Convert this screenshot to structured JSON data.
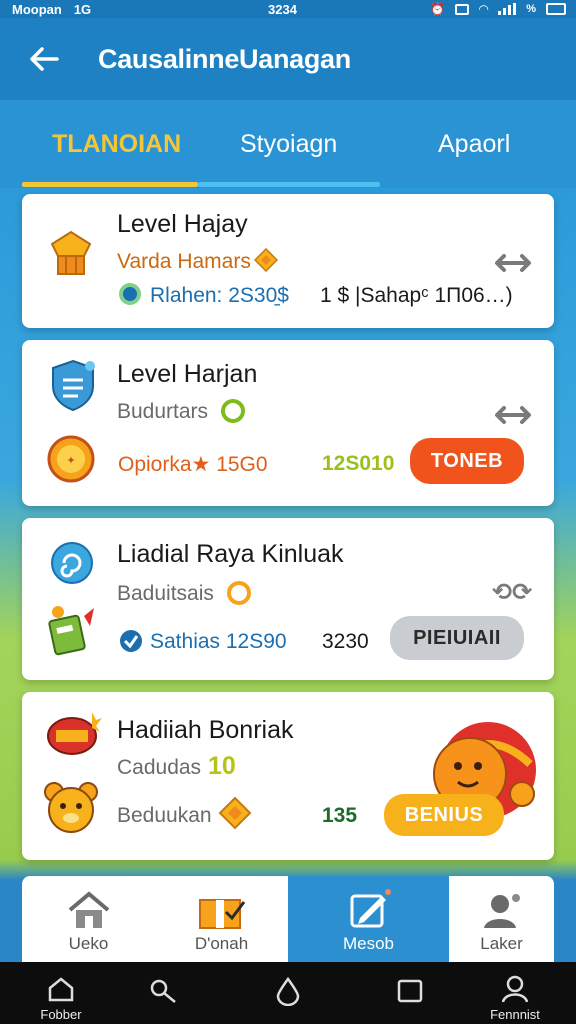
{
  "status_bar": {
    "carrier": "Moopan",
    "network": "1G",
    "time": "3234",
    "battery_text": "%"
  },
  "app_bar": {
    "back_icon": "arrow-left-icon",
    "title": "CausalinneUanagan"
  },
  "tabs": [
    {
      "label": "TLANOIAN",
      "active": true
    },
    {
      "label": "Styoiagn",
      "active": false
    },
    {
      "label": "Apaorl",
      "active": false
    }
  ],
  "cards": [
    {
      "title": "Level Hajay",
      "subtitle": "Varda Hamars",
      "stat_label": "Rlahen: 2S30̱$",
      "reward": "1 $ |Sahapᶜ 1Π06…)",
      "action_icon": "swap-arrows-icon"
    },
    {
      "title": "Level Harjan",
      "subtitle": "Budurtars",
      "stat_label": "Opiorka★ 15G0",
      "value": "12S010",
      "button": "TONEB",
      "action_icon": "swap-arrows-icon"
    },
    {
      "title": "Liadial Raya Kinluak",
      "subtitle": "Baduitsais",
      "stat_label": "Sathias 12S90",
      "value": "3230",
      "button": "PIEIUIAII",
      "action_icon": "refresh-icon"
    },
    {
      "title": "Hadiiah Bonriak",
      "subtitle": "Cadudas",
      "subtitle_value": "10",
      "stat_label": "Beduukan",
      "value": "135",
      "button": "BENIUS"
    }
  ],
  "bottom_nav": [
    {
      "label": "Ueko",
      "icon": "home-icon",
      "active": false
    },
    {
      "label": "D'onah",
      "icon": "gift-box-icon",
      "active": false
    },
    {
      "label": "Mesob",
      "icon": "edit-icon",
      "active": true
    },
    {
      "label": "Laker",
      "icon": "profile-icon",
      "active": false
    }
  ],
  "system_nav": [
    {
      "label": "Fobber",
      "icon": "home-outline-icon"
    },
    {
      "label": "",
      "icon": "search-icon"
    },
    {
      "label": "",
      "icon": "drop-icon"
    },
    {
      "label": "",
      "icon": "square-icon"
    },
    {
      "label": "Fennnist",
      "icon": "person-icon"
    }
  ],
  "colors": {
    "primary": "#1d81c3",
    "tab_active": "#f3c63a",
    "orange_button": "#f0541c",
    "grey_button": "#c9ccd1",
    "yellow_button": "#f7b21b",
    "green_value": "#9cbf1a"
  }
}
